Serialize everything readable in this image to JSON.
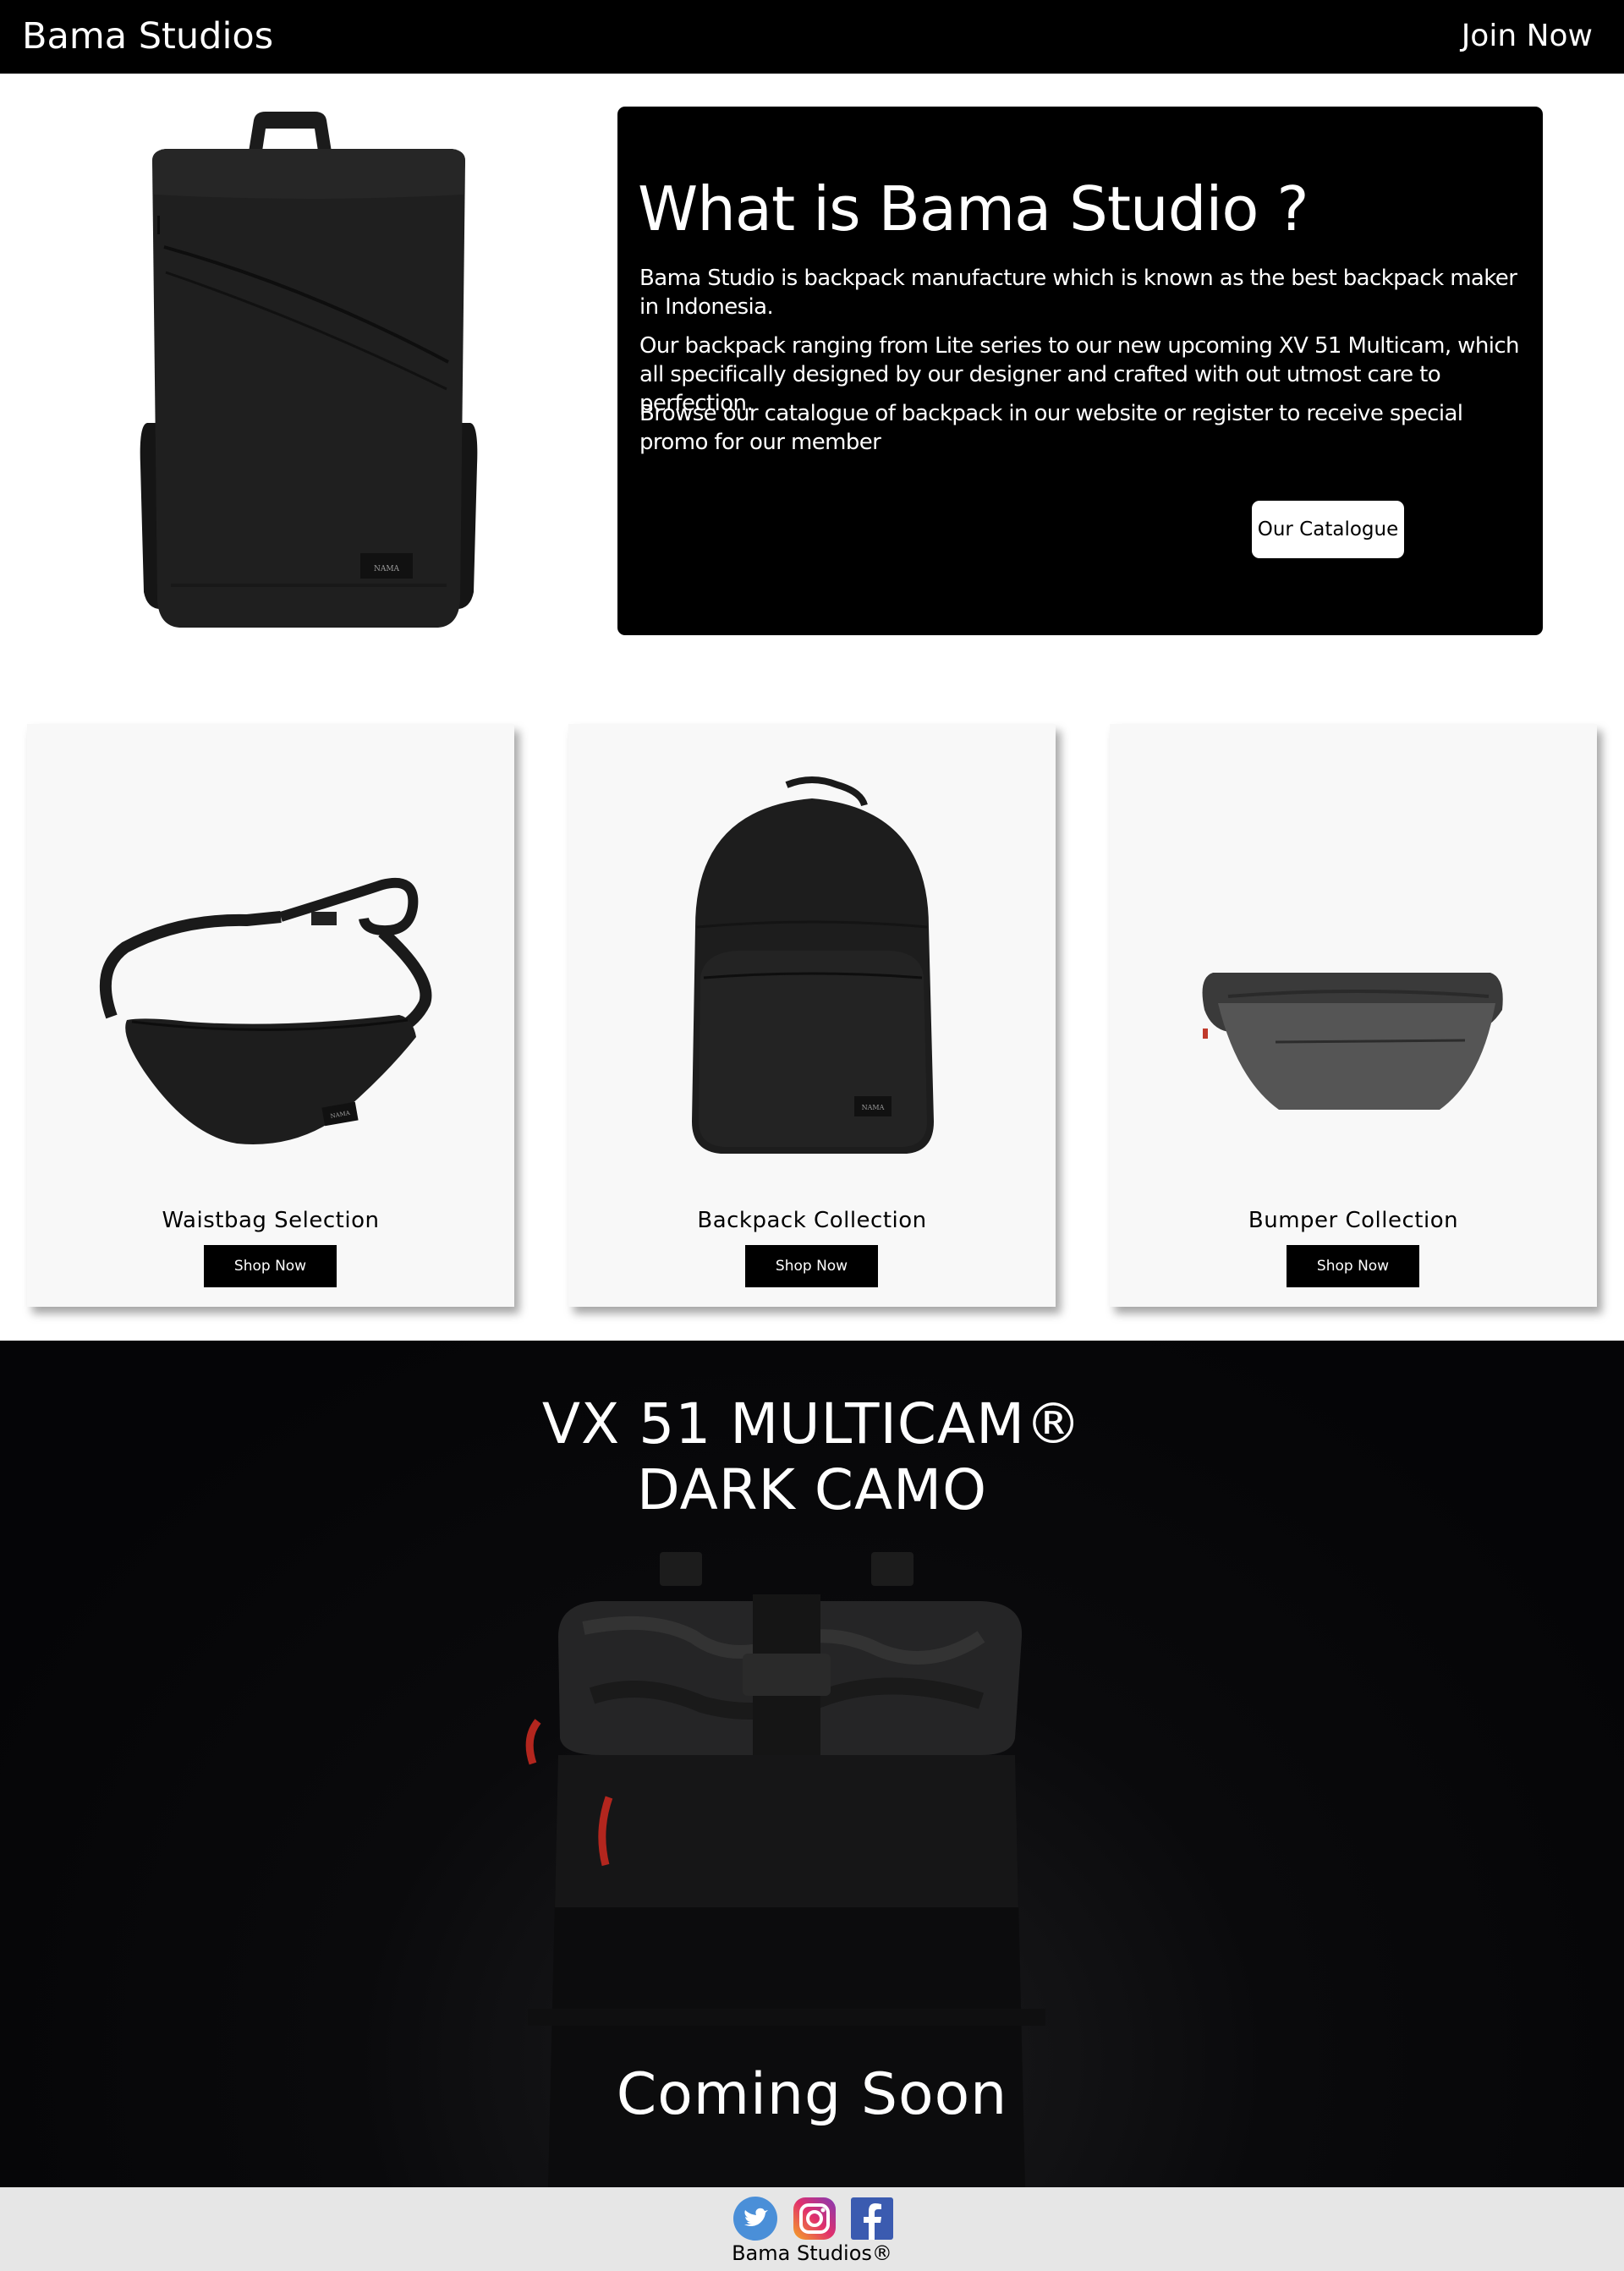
{
  "navbar": {
    "brand": "Bama Studios",
    "join": "Join Now"
  },
  "about": {
    "heading": "What is Bama Studio ?",
    "paragraphs": [
      "Bama Studio is backpack manufacture which is known as the best backpack maker in Indonesia.",
      "Our backpack ranging from Lite series to our new upcoming XV 51 Multicam, which all specifically designed by our designer and crafted with out utmost care to perfection.",
      "Browse our catalogue of backpack in our website or register to receive special promo for our member"
    ],
    "button": "Our Catalogue"
  },
  "hero_image": {
    "label": "NAMA"
  },
  "cards": [
    {
      "title": "Waistbag Selection",
      "button": "Shop Now",
      "tag": "NAMA"
    },
    {
      "title": "Backpack Collection",
      "button": "Shop Now",
      "tag": "NAMA"
    },
    {
      "title": "Bumper Collection",
      "button": "Shop Now"
    }
  ],
  "promo": {
    "line1": "VX 51 MULTICAM®",
    "line2": "DARK CAMO",
    "coming": "Coming Soon"
  },
  "footer": {
    "icons": [
      "twitter-icon",
      "instagram-icon",
      "facebook-icon"
    ],
    "text": "Bama Studios®"
  }
}
